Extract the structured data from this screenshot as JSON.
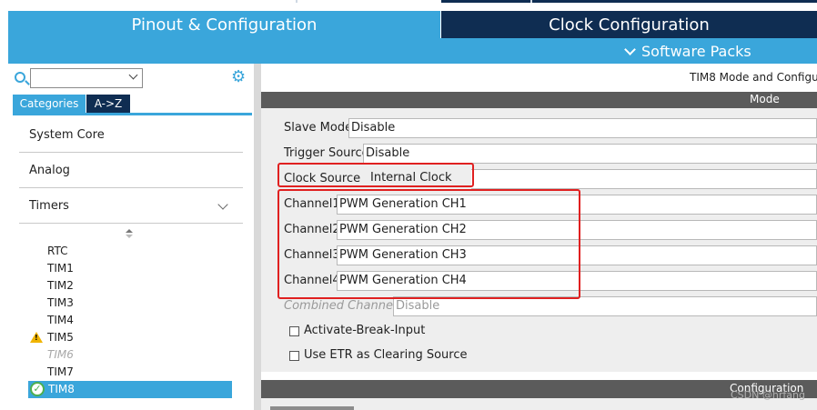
{
  "tabs": {
    "pinout": "Pinout & Configuration",
    "clock": "Clock Configuration",
    "software_packs": "Software Packs"
  },
  "sidebar": {
    "category_tab": "Categories",
    "az_tab": "A->Z",
    "categories": [
      {
        "label": "System Core",
        "state": "collapsed"
      },
      {
        "label": "Analog",
        "state": "collapsed"
      },
      {
        "label": "Timers",
        "state": "expanded"
      }
    ],
    "timers": [
      {
        "label": "RTC",
        "status": "normal"
      },
      {
        "label": "TIM1",
        "status": "normal"
      },
      {
        "label": "TIM2",
        "status": "normal"
      },
      {
        "label": "TIM3",
        "status": "normal"
      },
      {
        "label": "TIM4",
        "status": "normal"
      },
      {
        "label": "TIM5",
        "status": "warning"
      },
      {
        "label": "TIM6",
        "status": "disabled"
      },
      {
        "label": "TIM7",
        "status": "normal"
      },
      {
        "label": "TIM8",
        "status": "selected"
      }
    ]
  },
  "main": {
    "title": "TIM8 Mode and Configu",
    "mode_header": "Mode",
    "fields": {
      "slave_mode": {
        "label": "Slave Mode",
        "value": "Disable"
      },
      "trigger_source": {
        "label": "Trigger Source",
        "value": "Disable"
      },
      "clock_source": {
        "label": "Clock Source",
        "value": "Internal Clock"
      },
      "channel1": {
        "label": "Channel1",
        "value": "PWM Generation CH1"
      },
      "channel2": {
        "label": "Channel2",
        "value": "PWM Generation CH2"
      },
      "channel3": {
        "label": "Channel3",
        "value": "PWM Generation CH3"
      },
      "channel4": {
        "label": "Channel4",
        "value": "PWM Generation CH4"
      },
      "combined_channels": {
        "label": "Combined Channels",
        "value": "Disable"
      }
    },
    "checkboxes": {
      "activate_break_input": {
        "label": "Activate-Break-Input",
        "checked": false
      },
      "use_etr": {
        "label": "Use ETR as Clearing Source",
        "checked": false
      }
    },
    "configuration_header": "Configuration"
  },
  "watermark": "CSDN @hrfang",
  "colors": {
    "primary": "#3aa6db",
    "dark": "#0f2d52",
    "highlight": "#e02020",
    "section_bar": "#5b5b5b"
  }
}
